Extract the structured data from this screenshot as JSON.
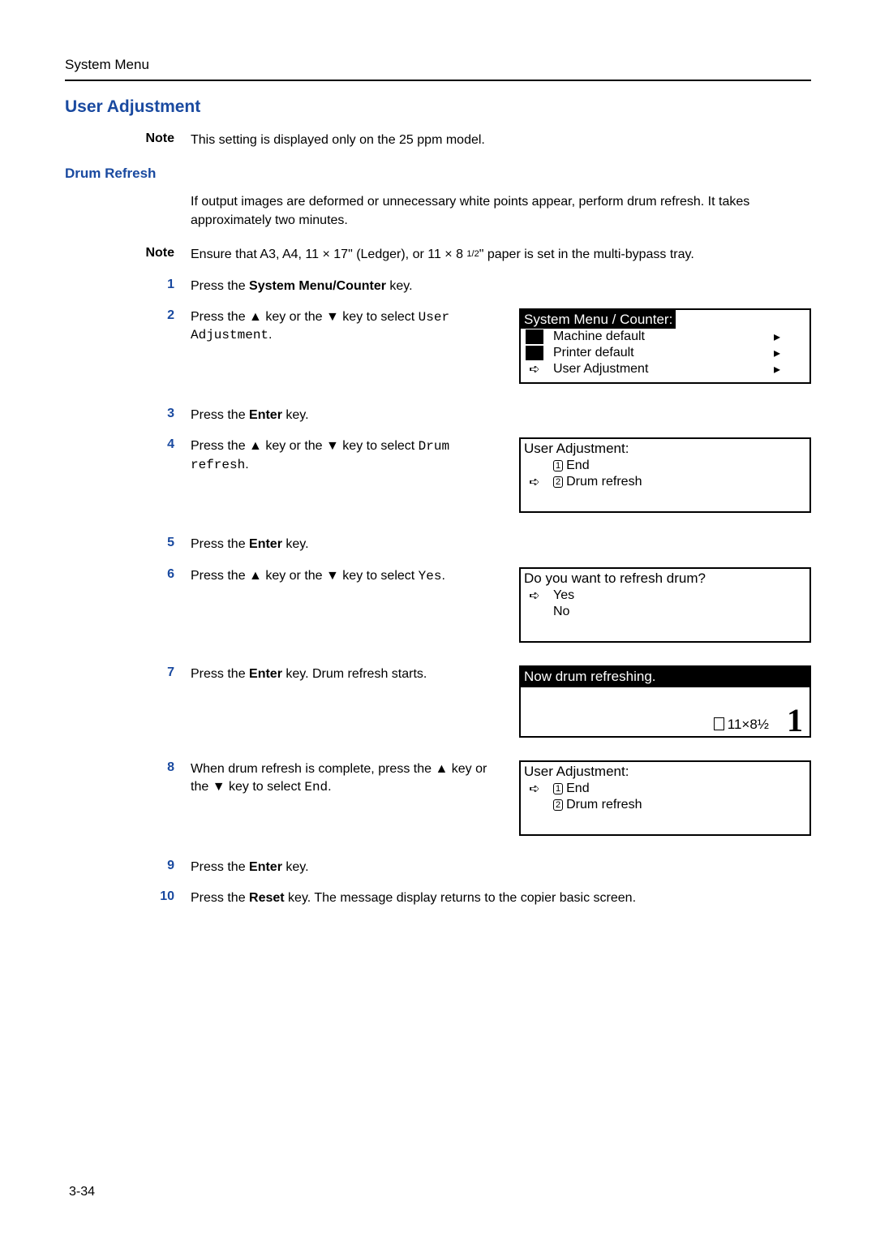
{
  "header": "System Menu",
  "section_title": "User Adjustment",
  "note1_label": "Note",
  "note1_text": "This setting is displayed only on the 25 ppm model.",
  "sub_heading": "Drum Refresh",
  "intro_para": "If output images are deformed or unnecessary white points appear, perform drum refresh. It takes approximately two minutes.",
  "note2_label": "Note",
  "note2_text_a": "Ensure that A3, A4, 11 × 17\" (Ledger), or 11 × 8 ",
  "note2_text_frac": "1/2",
  "note2_text_b": "\" paper is set in the multi-bypass tray.",
  "steps": {
    "s1": {
      "num": "1",
      "a": "Press the ",
      "b": "System Menu/Counter",
      "c": " key."
    },
    "s2": {
      "num": "2",
      "a": "Press the ▲ key or the ▼ key to select ",
      "mono1": "User Adjustment",
      "c": "."
    },
    "s3": {
      "num": "3",
      "a": "Press the ",
      "b": "Enter",
      "c": " key."
    },
    "s4": {
      "num": "4",
      "a": "Press the ▲ key or the ▼ key to select ",
      "mono1": "Drum refresh",
      "c": "."
    },
    "s5": {
      "num": "5",
      "a": "Press the ",
      "b": "Enter",
      "c": " key."
    },
    "s6": {
      "num": "6",
      "a": "Press the ▲ key or the ▼ key to select ",
      "mono1": "Yes",
      "c": "."
    },
    "s7": {
      "num": "7",
      "a": "Press the ",
      "b": "Enter",
      "c": " key. Drum refresh starts."
    },
    "s8": {
      "num": "8",
      "a": "When drum refresh is complete, press the ▲ key or the ▼ key to select ",
      "mono1": "End",
      "c": "."
    },
    "s9": {
      "num": "9",
      "a": "Press the ",
      "b": "Enter",
      "c": " key."
    },
    "s10": {
      "num": "10",
      "a": "Press the ",
      "b": "Reset",
      "c": " key. The message display returns to the copier basic screen."
    }
  },
  "lcd2": {
    "title": "System Menu / Counter:",
    "l1": "Machine default",
    "l2": "Printer default",
    "l3": "User Adjustment"
  },
  "lcd4": {
    "title": "User Adjustment:",
    "l1": "End",
    "l2": "Drum refresh"
  },
  "lcd6": {
    "title": "Do you want to refresh drum?",
    "l1": "Yes",
    "l2": "No"
  },
  "lcd7": {
    "title": "Now drum refreshing.",
    "size": "11×8½",
    "count": "1"
  },
  "lcd8": {
    "title": "User Adjustment:",
    "l1": "End",
    "l2": "Drum refresh"
  },
  "page_num": "3-34"
}
